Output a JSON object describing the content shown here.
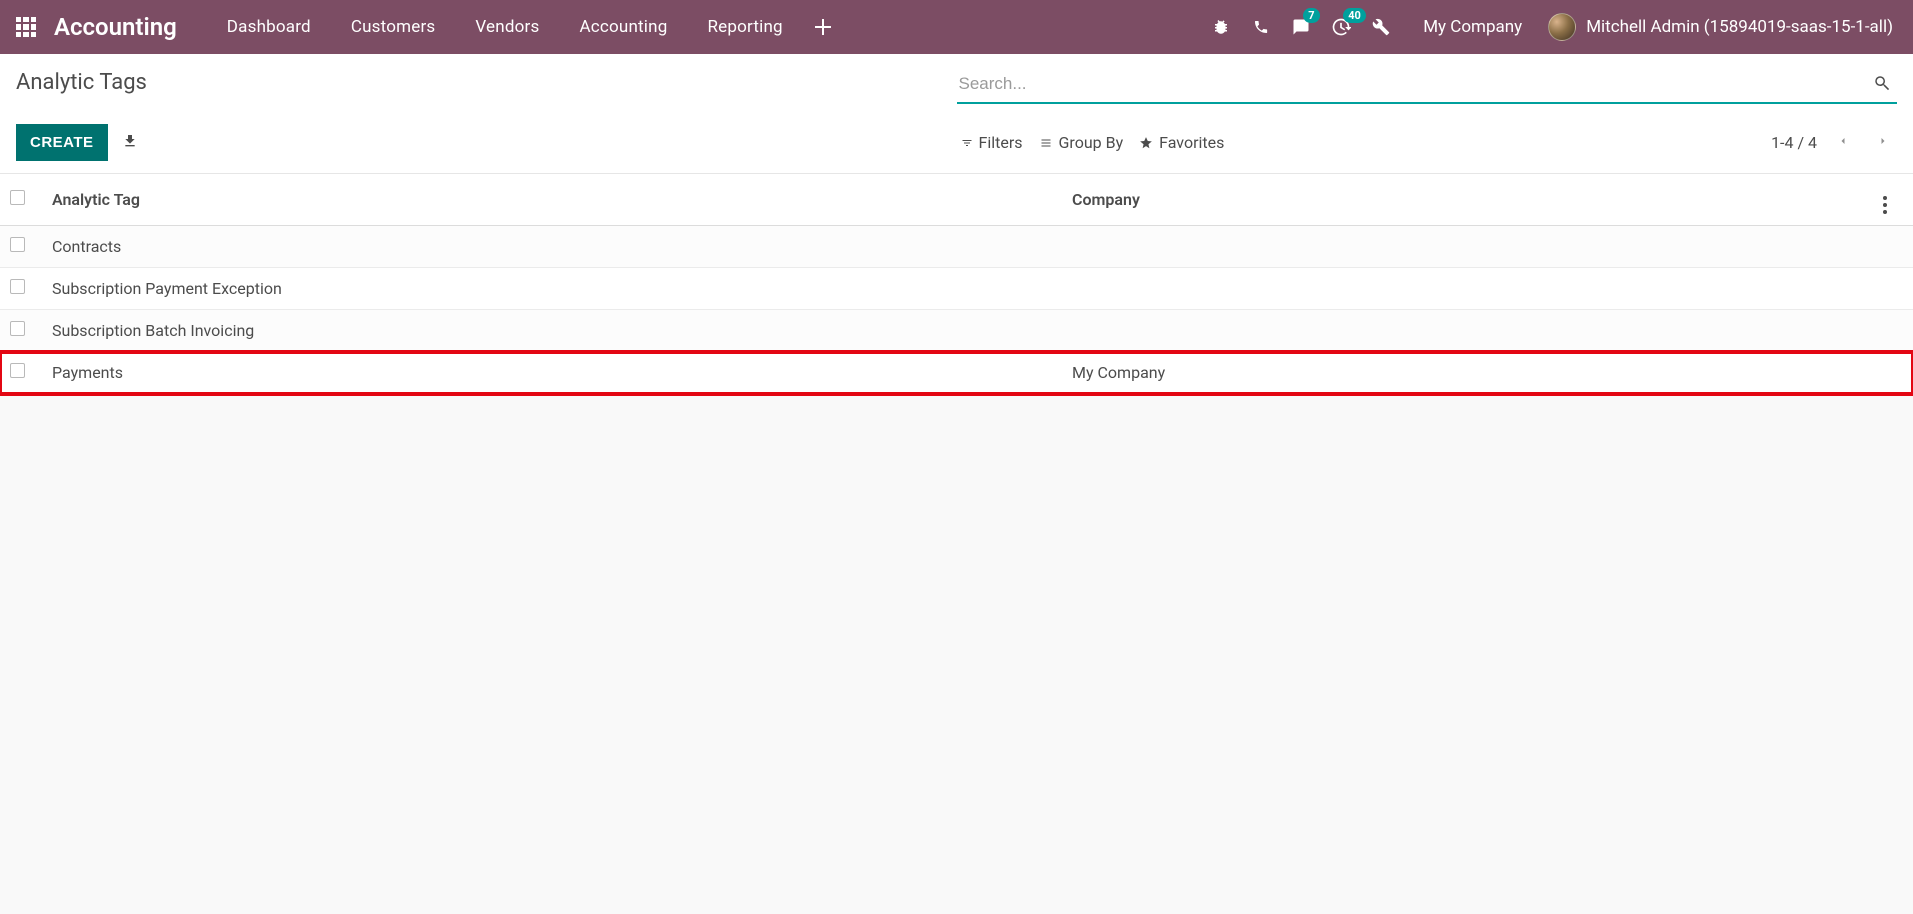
{
  "nav": {
    "brand": "Accounting",
    "items": [
      "Dashboard",
      "Customers",
      "Vendors",
      "Accounting",
      "Reporting"
    ],
    "messages_badge": "7",
    "activities_badge": "40",
    "company": "My Company",
    "user": "Mitchell Admin (15894019-saas-15-1-all)"
  },
  "cp": {
    "breadcrumb": "Analytic Tags",
    "create": "CREATE",
    "search_placeholder": "Search...",
    "filters": "Filters",
    "groupby": "Group By",
    "favorites": "Favorites",
    "pager": "1-4 / 4"
  },
  "table": {
    "col_tag": "Analytic Tag",
    "col_company": "Company",
    "rows": [
      {
        "tag": "Contracts",
        "company": ""
      },
      {
        "tag": "Subscription Payment Exception",
        "company": ""
      },
      {
        "tag": "Subscription Batch Invoicing",
        "company": ""
      },
      {
        "tag": "Payments",
        "company": "My Company"
      }
    ]
  }
}
